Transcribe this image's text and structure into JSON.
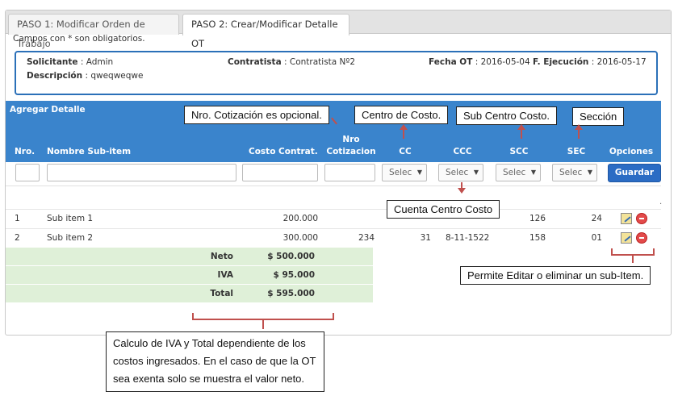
{
  "tabs": [
    {
      "label": "PASO 1: Modificar Orden de Trabajo"
    },
    {
      "label": "PASO 2: Crear/Modificar Detalle OT"
    }
  ],
  "required_note": "Campos con * son obligatorios.",
  "info": {
    "solicitante_label": "Solicitante",
    "solicitante_value": ": Admin",
    "contratista_label": "Contratista",
    "contratista_value": ": Contratista Nº2",
    "fecha_ot_label": "Fecha OT",
    "fecha_ot_value": ": 2016-05-04",
    "fecha_ejec_label": "F. Ejecución",
    "fecha_ejec_value": ": 2016-05-17",
    "descripcion_label": "Descripción",
    "descripcion_value": ": qweqweqwe"
  },
  "panel_title": "Agregar Detalle",
  "columns": {
    "nro": "Nro.",
    "nombre": "Nombre Sub-item",
    "costo": "Costo Contrat.",
    "cotizacion_1": "Nro",
    "cotizacion_2": "Cotizacion",
    "cc": "CC",
    "ccc": "CCC",
    "scc": "SCC",
    "sec": "SEC",
    "opciones": "Opciones"
  },
  "select_placeholder": "Selec",
  "save_label": "Guardar",
  "rows": [
    {
      "nro": "1",
      "nombre": "Sub item 1",
      "costo": "200.000",
      "cotizacion": "",
      "cc": "",
      "ccc": "",
      "scc": "126",
      "sec": "24"
    },
    {
      "nro": "2",
      "nombre": "Sub item 2",
      "costo": "300.000",
      "cotizacion": "234",
      "cc": "31",
      "ccc": "8-11-1522",
      "scc": "158",
      "sec": "01"
    }
  ],
  "totals": [
    {
      "label": "Neto",
      "value": "$ 500.000"
    },
    {
      "label": "IVA",
      "value": "$ 95.000"
    },
    {
      "label": "Total",
      "value": "$ 595.000"
    }
  ],
  "callouts": {
    "cotizacion": "Nro. Cotización es opcional.",
    "centro_costo": "Centro de Costo.",
    "sub_centro": "Sub Centro Costo.",
    "seccion": "Sección",
    "cuenta": "Cuenta Centro Costo",
    "opciones": "Permite Editar o eliminar un sub-Item.",
    "totales": "Calculo de IVA y Total dependiente de los costos ingresados. En el caso de que la OT sea exenta solo se muestra el valor neto."
  },
  "colors": {
    "header_blue": "#3a84cc",
    "info_border": "#2b70b8",
    "totals_green": "#dff0d8",
    "annotation_red": "#c0504d"
  }
}
